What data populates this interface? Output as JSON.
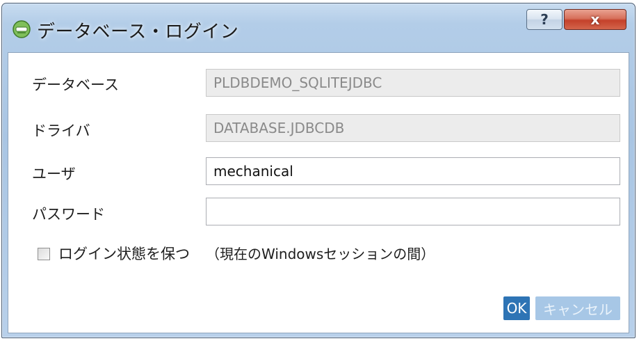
{
  "window": {
    "title": "データベース・ログイン",
    "help_label": "?",
    "close_label": "x"
  },
  "form": {
    "database": {
      "label": "データベース",
      "value": "PLDBDEMO_SQLITEJDBC"
    },
    "driver": {
      "label": "ドライバ",
      "value": "DATABASE.JDBCDB"
    },
    "user": {
      "label": "ユーザ",
      "value": "mechanical"
    },
    "password": {
      "label": "パスワード",
      "value": ""
    },
    "keep_login": {
      "label": "ログイン状態を保つ",
      "note": "（現在のWindowsセッションの間）",
      "checked": false
    }
  },
  "buttons": {
    "ok": "OK",
    "cancel": "キャンセル"
  },
  "colors": {
    "accent": "#2e74b5",
    "accent_disabled": "#a7c7e6",
    "close": "#c4412a"
  }
}
